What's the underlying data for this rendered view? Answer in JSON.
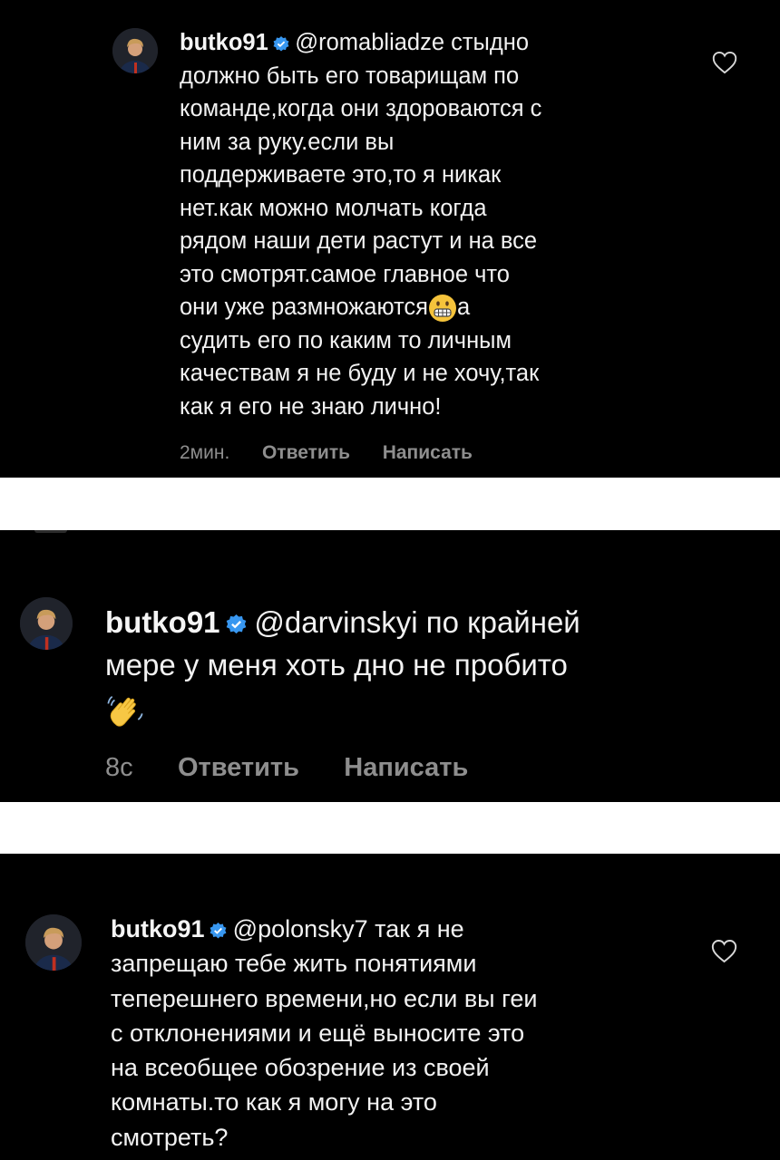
{
  "comments": [
    {
      "username": "butko91",
      "mention": "@romabliadze",
      "text_first": " стыдно",
      "lines": [
        "должно быть его товарищам по",
        "команде,когда они здороваются с",
        "ним за руку.если вы",
        "поддерживаете это,то я никак",
        "нет.как можно молчать когда",
        "рядом наши дети растут и на все",
        "это смотрят.самое главное что"
      ],
      "line_emoji_before": "они уже размножаются",
      "emoji": "grimacing-face",
      "line_emoji_after": "а",
      "lines_after": [
        "судить его по каким то личным",
        "качествам я не буду и не хочу,так",
        "как я его не знаю лично!"
      ],
      "time": "2мин.",
      "reply": "Ответить",
      "message": "Написать"
    },
    {
      "username": "butko91",
      "mention": "@darvinskyi",
      "text_first": " по крайней",
      "line2": "мере у меня хоть дно не пробито",
      "emoji": "waving-hand",
      "time": "8с",
      "reply": "Ответить",
      "message": "Написать"
    },
    {
      "username": "butko91",
      "mention": "@polonsky7",
      "text_first": " так я не",
      "lines": [
        "запрещаю тебе жить понятиями",
        "теперешнего времени,но если вы геи",
        "с отклонениями и ещё выносите это",
        "на всеобщее обозрение из своей",
        "комнаты.то как я могу на это",
        "смотреть?"
      ]
    }
  ],
  "colors": {
    "verified": "#3897f0",
    "meta": "#8e8e8e",
    "background": "#000000"
  }
}
